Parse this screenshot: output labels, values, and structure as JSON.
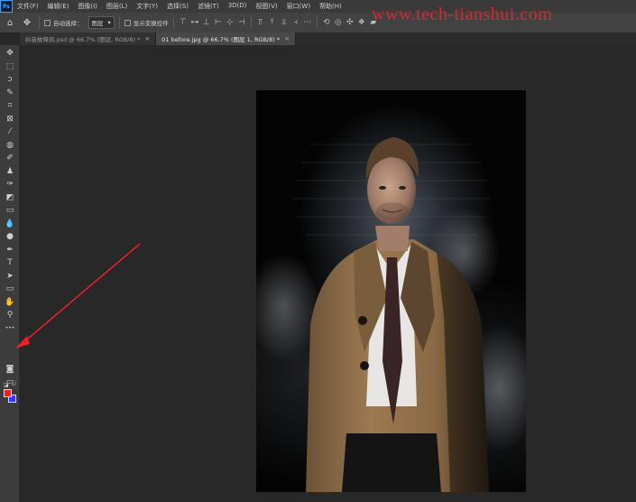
{
  "app": {
    "logo": "Ps"
  },
  "menu": [
    "文件(F)",
    "编辑(E)",
    "图像(I)",
    "图层(L)",
    "文字(Y)",
    "选择(S)",
    "滤镜(T)",
    "3D(D)",
    "视图(V)",
    "窗口(W)",
    "帮助(H)"
  ],
  "options": {
    "auto_select_label": "自动选择：",
    "layer_select": "图层",
    "show_transform_label": "显示变换控件"
  },
  "watermark": "www.tech-tianshui.com",
  "tabs": [
    {
      "label": "抖音故障风.psd @ 66.7% (图层, RGB/8) *",
      "active": false
    },
    {
      "label": "01 before.jpg @ 66.7% (图层 1, RGB/8) *",
      "active": true
    }
  ],
  "toolbar": {
    "tools": [
      {
        "name": "move-tool",
        "glyph": "✥"
      },
      {
        "name": "marquee-tool",
        "glyph": "⬚"
      },
      {
        "name": "lasso-tool",
        "glyph": "ↄ"
      },
      {
        "name": "quick-select-tool",
        "glyph": "✎"
      },
      {
        "name": "crop-tool",
        "glyph": "⌗"
      },
      {
        "name": "frame-tool",
        "glyph": "⊠"
      },
      {
        "name": "eyedropper-tool",
        "glyph": "⁄"
      },
      {
        "name": "healing-tool",
        "glyph": "◍"
      },
      {
        "name": "brush-tool",
        "glyph": "✐"
      },
      {
        "name": "stamp-tool",
        "glyph": "♟"
      },
      {
        "name": "history-brush-tool",
        "glyph": "✑"
      },
      {
        "name": "eraser-tool",
        "glyph": "◩"
      },
      {
        "name": "gradient-tool",
        "glyph": "▭"
      },
      {
        "name": "blur-tool",
        "glyph": "💧"
      },
      {
        "name": "dodge-tool",
        "glyph": "●"
      },
      {
        "name": "pen-tool",
        "glyph": "✒"
      },
      {
        "name": "type-tool",
        "glyph": "T"
      },
      {
        "name": "path-select-tool",
        "glyph": "➤"
      },
      {
        "name": "rectangle-tool",
        "glyph": "▭"
      },
      {
        "name": "hand-tool",
        "glyph": "✋"
      },
      {
        "name": "zoom-tool",
        "glyph": "⚲"
      },
      {
        "name": "more-tools",
        "glyph": "•••"
      }
    ],
    "foreground_color": "#ff1a1a",
    "background_color": "#2a3cff"
  },
  "colors": {
    "arrow": "#e8202a",
    "watermark": "#e62832"
  }
}
